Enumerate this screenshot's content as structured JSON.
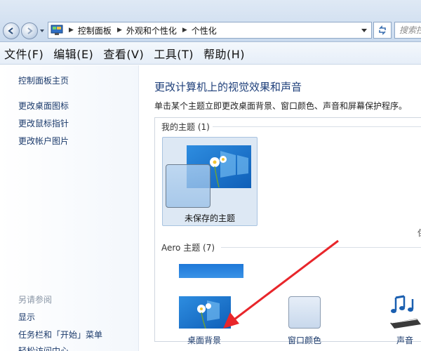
{
  "address_bar": {
    "breadcrumbs": [
      "控制面板",
      "外观和个性化",
      "个性化"
    ],
    "search_placeholder": "搜索控制面板"
  },
  "menu": {
    "items": [
      "文件(F)",
      "编辑(E)",
      "查看(V)",
      "工具(T)",
      "帮助(H)"
    ]
  },
  "sidebar": {
    "links": [
      "控制面板主页",
      "更改桌面图标",
      "更改鼠标指针",
      "更改帐户图片"
    ],
    "see_also_title": "另请参阅",
    "see_also_links": [
      "显示",
      "任务栏和「开始」菜单",
      "轻松访问中心"
    ]
  },
  "main": {
    "title": "更改计算机上的视觉效果和声音",
    "description": "单击某个主题立即更改桌面背景、窗口颜色、声音和屏幕保护程序。",
    "my_themes_label": "我的主题 (1)",
    "unsaved_theme_name": "未保存的主题",
    "peek_text": "保",
    "aero_label": "Aero 主题 (7)"
  },
  "bottom_bar": {
    "desktop_background": "桌面背景",
    "window_color": "窗口颜色",
    "sounds": "声音"
  },
  "colors": {
    "accent_title": "#1e3f7a",
    "link": "#1b3a6b",
    "annotation_arrow": "#e8262b"
  },
  "icons": [
    "back-arrow-icon",
    "forward-arrow-icon",
    "control-panel-icon",
    "refresh-icon",
    "music-notes-icon"
  ]
}
